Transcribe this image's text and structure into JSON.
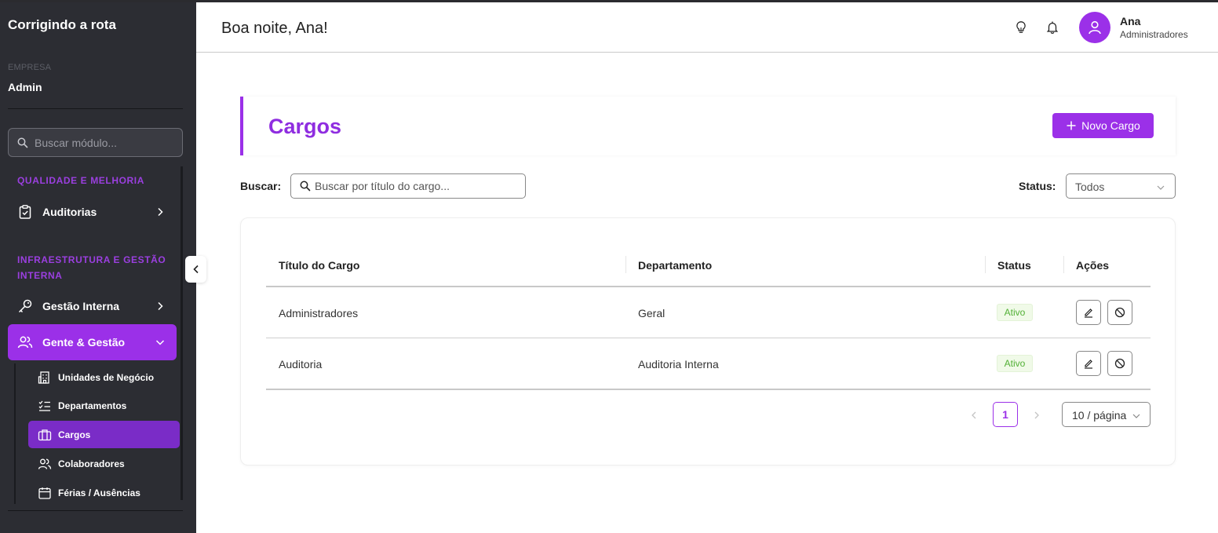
{
  "sidebar": {
    "brand": "Corrigindo a rota",
    "company_label": "EMPRESA",
    "company_value": "Admin",
    "search_placeholder": "Buscar módulo...",
    "sections": [
      {
        "title": "QUALIDADE E MELHORIA"
      },
      {
        "title": "INFRAESTRUTURA E GESTÃO INTERNA"
      }
    ],
    "items": [
      {
        "label": "Auditorias",
        "icon": "clipboard-check-icon"
      },
      {
        "label": "Gestão Interna",
        "icon": "key-icon"
      },
      {
        "label": "Gente & Gestão",
        "icon": "users-icon",
        "active": true
      }
    ],
    "subitems": [
      {
        "label": "Unidades de Negócio",
        "icon": "building-icon"
      },
      {
        "label": "Departamentos",
        "icon": "checklist-icon"
      },
      {
        "label": "Cargos",
        "icon": "briefcase-icon",
        "active": true
      },
      {
        "label": "Colaboradores",
        "icon": "users-icon"
      },
      {
        "label": "Férias / Ausências",
        "icon": "calendar-icon"
      }
    ]
  },
  "header": {
    "greeting": "Boa noite, Ana!",
    "user_name": "Ana",
    "user_role": "Administradores"
  },
  "main": {
    "title": "Cargos",
    "new_button": "Novo Cargo",
    "search_label": "Buscar:",
    "search_placeholder": "Buscar por título do cargo...",
    "status_label": "Status:",
    "status_value": "Todos",
    "table": {
      "columns": [
        "Título do Cargo",
        "Departamento",
        "Status",
        "Ações"
      ],
      "rows": [
        {
          "title": "Administradores",
          "department": "Geral",
          "status": "Ativo"
        },
        {
          "title": "Auditoria",
          "department": "Auditoria Interna",
          "status": "Ativo"
        }
      ]
    },
    "pagination": {
      "current_page": "1",
      "page_size": "10 / página"
    }
  },
  "colors": {
    "accent": "#9b30e8",
    "sidebar_bg": "#2c2d33",
    "active_sub": "#7a2cc7",
    "badge_green": "#52b036"
  }
}
